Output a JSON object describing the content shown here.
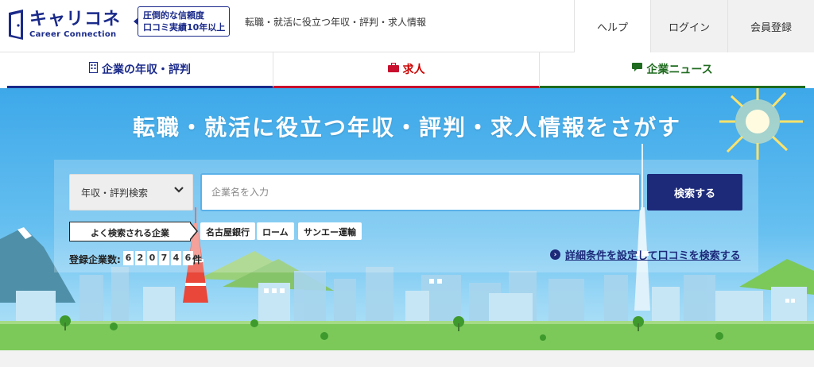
{
  "header": {
    "logo_main": "キャリコネ",
    "logo_sub": "Career Connection",
    "badge_line1": "圧倒的な信頼度",
    "badge_line2": "口コミ実績10年以上",
    "tagline": "転職・就活に役立つ年収・評判・求人情報",
    "help_label": "ヘルプ",
    "login_label": "ログイン",
    "register_label": "会員登録"
  },
  "nav": {
    "tabs": [
      {
        "label": "企業の年収・評判",
        "icon": "building-icon",
        "color": "#1a2a8a"
      },
      {
        "label": "求人",
        "icon": "briefcase-icon",
        "color": "#c8102e"
      },
      {
        "label": "企業ニュース",
        "icon": "chat-bubble-icon",
        "color": "#1f6b1f"
      }
    ]
  },
  "hero": {
    "title": "転職・就活に役立つ年収・評判・求人情報をさがす",
    "search_type": "年収・評判検索",
    "search_placeholder": "企業名を入力",
    "search_button": "検索する",
    "popular_label": "よく検索される企業",
    "popular_companies": [
      "名古屋銀行",
      "ローム",
      "サンエー運輸"
    ],
    "count_label": "登録企業数:",
    "count_digits": [
      "6",
      "2",
      "0",
      "7",
      "4",
      "6"
    ],
    "count_unit": "件",
    "detail_link": "詳細条件を設定して口コミを検索する"
  },
  "colors": {
    "brand": "#1a2a8a",
    "button": "#1d2a7a",
    "sky": "#3da8e9",
    "grass": "#7cc95a"
  }
}
